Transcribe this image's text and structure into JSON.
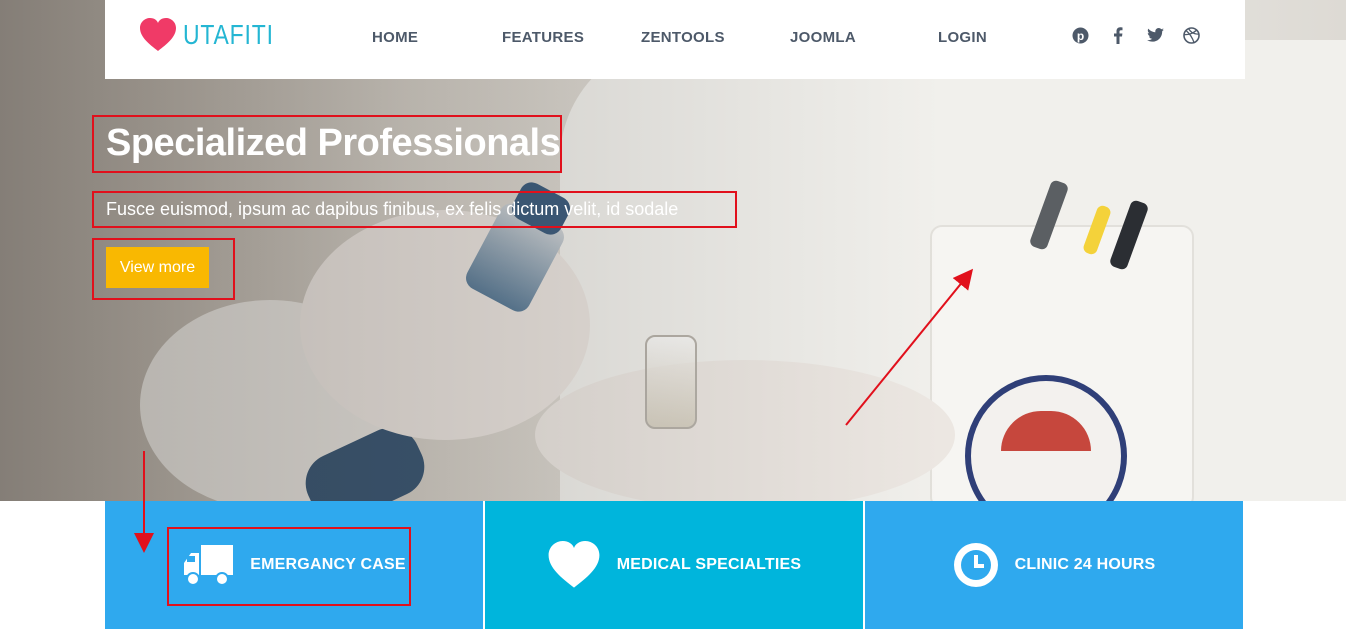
{
  "header": {
    "brand_name": "UTAFITI",
    "brand_color": "#24b6d3",
    "heart_color": "#f03a67",
    "nav": [
      {
        "label": "HOME"
      },
      {
        "label": "FEATURES"
      },
      {
        "label": "ZENTOOLS"
      },
      {
        "label": "JOOMLA"
      },
      {
        "label": "LOGIN"
      }
    ],
    "social_icons": [
      "pinterest-icon",
      "facebook-icon",
      "twitter-icon",
      "dribbble-icon"
    ]
  },
  "hero": {
    "title": "Specialized Professionals",
    "subtitle": "Fusce euismod, ipsum ac dapibus finibus, ex felis dictum velit, id sodale",
    "button_label": "View more",
    "button_color": "#f9b801"
  },
  "features": [
    {
      "label": "EMERGANCY CASE",
      "icon": "truck-icon",
      "color": "#2fa9ee"
    },
    {
      "label": "MEDICAL SPECIALTIES",
      "icon": "heart-icon",
      "color": "#00b5dc"
    },
    {
      "label": "CLINIC 24 HOURS",
      "icon": "clock-icon",
      "color": "#2fa9ee"
    }
  ],
  "annotations": {
    "color": "#e1101c"
  }
}
